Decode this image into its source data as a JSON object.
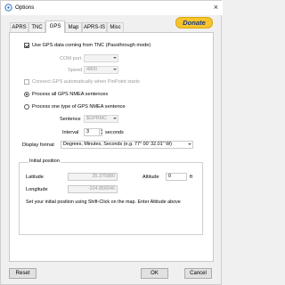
{
  "window": {
    "title": "Options"
  },
  "tabs": [
    {
      "label": "APRS",
      "active": false
    },
    {
      "label": "TNC",
      "active": false
    },
    {
      "label": "GPS",
      "active": true
    },
    {
      "label": "Map",
      "active": false
    },
    {
      "label": "APRS-IS",
      "active": false
    },
    {
      "label": "Misc",
      "active": false
    }
  ],
  "donate_label": "Donate",
  "gps": {
    "use_gps_label": "Use GPS data coming from TNC (Passthrough mode)",
    "use_gps_checked": true,
    "com_port_label": "COM port",
    "com_port_value": "",
    "speed_label": "Speed",
    "speed_value": "4800",
    "connect_auto_label": "Connect GPS automatically when PinPoint starts",
    "connect_auto_checked": false,
    "process_all_label": "Process all GPS NMEA sentences",
    "process_one_label": "Process one type of GPS NMEA sentence",
    "sentence_label": "Sentence",
    "sentence_value": "$GPRMC",
    "interval_label": "Interval",
    "interval_value": "3",
    "interval_unit": "seconds",
    "display_format_label": "Display format",
    "display_format_value": "Degrees, Minutes, Seconds (e.g. 77° 00' 32.01\" W)"
  },
  "initial_position": {
    "group_title": "Initial position",
    "latitude_label": "Latitude",
    "latitude_value": "35.375880",
    "altitude_label": "Altitude",
    "altitude_value": "0",
    "altitude_unit": "ft",
    "longitude_label": "Longitude",
    "longitude_value": "-104.856046",
    "hint": "Set your initial position using Shift-Click on the map. Enter Altitude above"
  },
  "buttons": {
    "reset": "Reset",
    "ok": "OK",
    "cancel": "Cancel"
  },
  "colors": {
    "donate_bg": "#f6c42b",
    "donate_text": "#1b3a8a"
  }
}
